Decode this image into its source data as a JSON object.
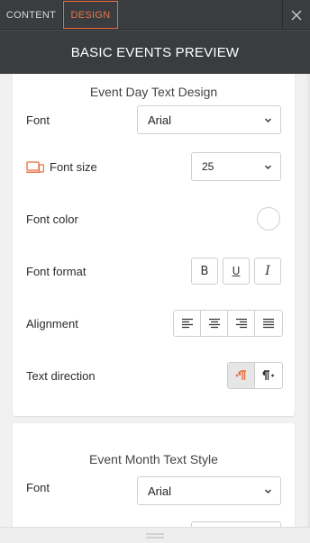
{
  "tabs": {
    "content_label": "CONTENT",
    "design_label": "DESIGN",
    "active": "design"
  },
  "header": {
    "title": "BASIC EVENTS PREVIEW"
  },
  "colors": {
    "accent": "#ea6a3a",
    "topbar": "#3a3d3f",
    "panel_bg": "#f1f1f1"
  },
  "day_section": {
    "title": "Event Day Text Design",
    "font_label": "Font",
    "font_value": "Arial",
    "font_size_label": "Font size",
    "font_size_value": "25",
    "font_size_icon": "responsive-devices-icon",
    "font_color_label": "Font color",
    "font_color_value": "#ffffff",
    "font_format_label": "Font format",
    "format_buttons": {
      "bold": "B",
      "underline": "U",
      "italic": "I"
    },
    "alignment_label": "Alignment",
    "alignment_options": [
      "left",
      "center",
      "right",
      "justify"
    ],
    "text_direction_label": "Text direction",
    "text_direction_options": [
      "ltr",
      "rtl"
    ],
    "text_direction_selected": "ltr"
  },
  "month_section": {
    "title": "Event Month Text Style",
    "font_label": "Font",
    "font_value": "Arial"
  }
}
